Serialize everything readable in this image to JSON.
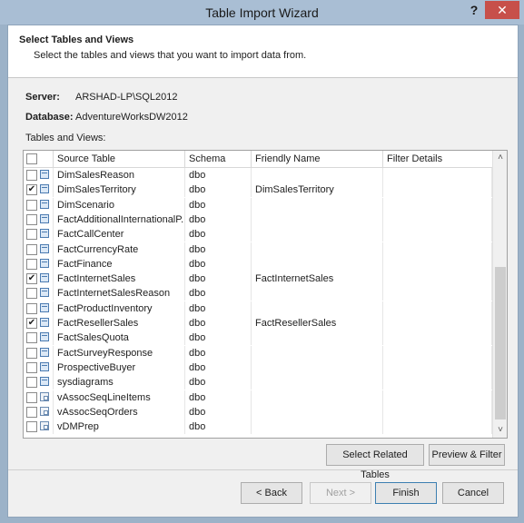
{
  "window": {
    "title": "Table Import Wizard",
    "help_label": "?",
    "close_label": "✕"
  },
  "header": {
    "title": "Select Tables and Views",
    "description": "Select the tables and views that you want to import data from."
  },
  "connection": {
    "server_label": "Server:",
    "server_value": "ARSHAD-LP\\SQL2012",
    "database_label": "Database:",
    "database_value": "AdventureWorksDW2012"
  },
  "grid": {
    "caption": "Tables and Views:",
    "columns": [
      "Source Table",
      "Schema",
      "Friendly Name",
      "Filter Details"
    ],
    "rows": [
      {
        "checked": false,
        "icon": "table-icon",
        "source": "DimSalesReason",
        "schema": "dbo",
        "friendly": "",
        "filter": ""
      },
      {
        "checked": true,
        "icon": "table-icon",
        "source": "DimSalesTerritory",
        "schema": "dbo",
        "friendly": "DimSalesTerritory",
        "filter": ""
      },
      {
        "checked": false,
        "icon": "table-icon",
        "source": "DimScenario",
        "schema": "dbo",
        "friendly": "",
        "filter": ""
      },
      {
        "checked": false,
        "icon": "table-icon",
        "source": "FactAdditionalInternationalP...",
        "schema": "dbo",
        "friendly": "",
        "filter": ""
      },
      {
        "checked": false,
        "icon": "table-icon",
        "source": "FactCallCenter",
        "schema": "dbo",
        "friendly": "",
        "filter": ""
      },
      {
        "checked": false,
        "icon": "table-icon",
        "source": "FactCurrencyRate",
        "schema": "dbo",
        "friendly": "",
        "filter": ""
      },
      {
        "checked": false,
        "icon": "table-icon",
        "source": "FactFinance",
        "schema": "dbo",
        "friendly": "",
        "filter": ""
      },
      {
        "checked": true,
        "icon": "table-icon",
        "source": "FactInternetSales",
        "schema": "dbo",
        "friendly": "FactInternetSales",
        "filter": ""
      },
      {
        "checked": false,
        "icon": "table-icon",
        "source": "FactInternetSalesReason",
        "schema": "dbo",
        "friendly": "",
        "filter": ""
      },
      {
        "checked": false,
        "icon": "table-icon",
        "source": "FactProductInventory",
        "schema": "dbo",
        "friendly": "",
        "filter": ""
      },
      {
        "checked": true,
        "icon": "table-icon",
        "source": "FactResellerSales",
        "schema": "dbo",
        "friendly": "FactResellerSales",
        "filter": ""
      },
      {
        "checked": false,
        "icon": "table-icon",
        "source": "FactSalesQuota",
        "schema": "dbo",
        "friendly": "",
        "filter": ""
      },
      {
        "checked": false,
        "icon": "table-icon",
        "source": "FactSurveyResponse",
        "schema": "dbo",
        "friendly": "",
        "filter": ""
      },
      {
        "checked": false,
        "icon": "table-icon",
        "source": "ProspectiveBuyer",
        "schema": "dbo",
        "friendly": "",
        "filter": ""
      },
      {
        "checked": false,
        "icon": "table-icon",
        "source": "sysdiagrams",
        "schema": "dbo",
        "friendly": "",
        "filter": ""
      },
      {
        "checked": false,
        "icon": "view-icon",
        "source": "vAssocSeqLineItems",
        "schema": "dbo",
        "friendly": "",
        "filter": ""
      },
      {
        "checked": false,
        "icon": "view-icon",
        "source": "vAssocSeqOrders",
        "schema": "dbo",
        "friendly": "",
        "filter": ""
      },
      {
        "checked": false,
        "icon": "view-icon",
        "source": "vDMPrep",
        "schema": "dbo",
        "friendly": "",
        "filter": ""
      }
    ],
    "scroll_up": "˄",
    "scroll_down": "˅"
  },
  "actions": {
    "select_related": "Select Related Tables",
    "preview_filter": "Preview & Filter"
  },
  "footer": {
    "back": "< Back",
    "next": "Next >",
    "finish": "Finish",
    "cancel": "Cancel"
  },
  "colors": {
    "title_bar": "#a9bed4",
    "close_button": "#c7504a",
    "default_button_border": "#3c7fb1"
  }
}
